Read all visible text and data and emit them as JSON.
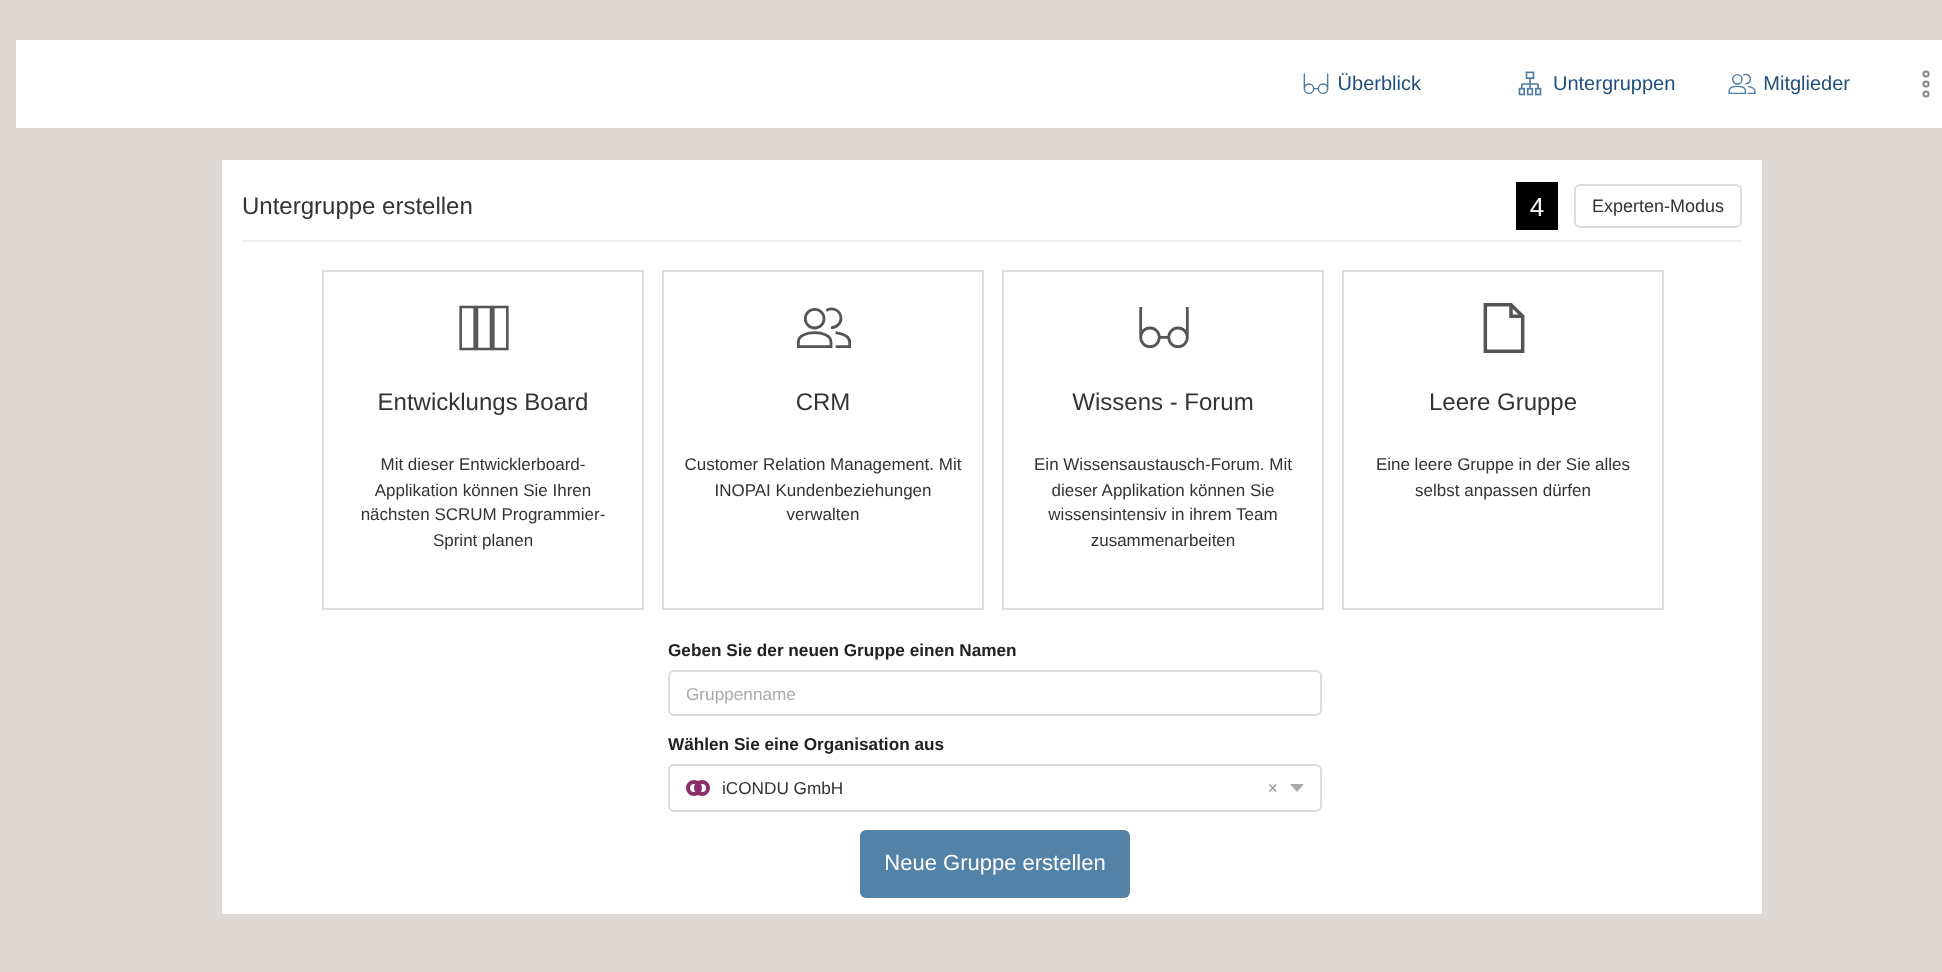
{
  "nav": [
    {
      "kind": "glasses",
      "label": "Überblick"
    },
    {
      "kind": "hierarchy",
      "label": "Untergruppen"
    },
    {
      "kind": "people",
      "label": "Mitglieder"
    }
  ],
  "panel": {
    "title": "Untergruppe erstellen",
    "badge": "4",
    "expert_button": "Experten-Modus"
  },
  "templates": [
    {
      "kind": "columns",
      "title": "Entwicklungs Board",
      "description": "Mit dieser Entwicklerboard-Applikation können Sie Ihren nächsten SCRUM Programmier-Sprint planen"
    },
    {
      "kind": "people",
      "title": "CRM",
      "description": "Customer Relation Management. Mit INOPAI Kundenbeziehungen verwalten"
    },
    {
      "kind": "glasses",
      "title": "Wissens - Forum",
      "description": "Ein Wissensaustausch-Forum. Mit dieser Applikation können Sie wissensintensiv in ihrem Team zusammenarbeiten"
    },
    {
      "kind": "document",
      "title": "Leere Gruppe",
      "description": "Eine leere Gruppe in der Sie alles selbst anpassen dürfen"
    }
  ],
  "form": {
    "name_label": "Geben Sie der neuen Gruppe einen Namen",
    "name_placeholder": "Gruppenname",
    "org_label": "Wählen Sie eine Organisation aus",
    "org_value": "iCONDU GmbH",
    "clear": "×",
    "submit": "Neue Gruppe erstellen"
  }
}
